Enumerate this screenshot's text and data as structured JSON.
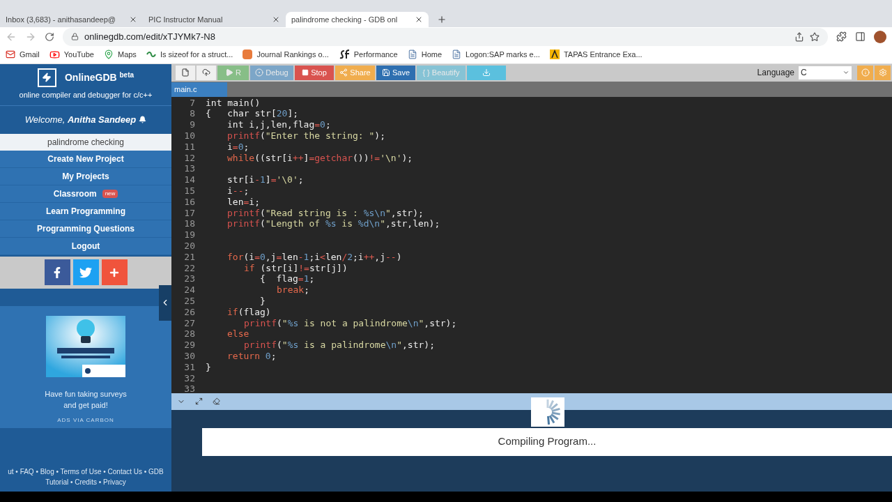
{
  "browser": {
    "tabs": [
      {
        "title": "Inbox (3,683) - anithasandeep@",
        "selected": false
      },
      {
        "title": "PIC Instructor Manual",
        "selected": false
      },
      {
        "title": "palindrome checking - GDB onl",
        "selected": true
      }
    ],
    "url": "onlinegdb.com/edit/xTJYMk7-N8",
    "bookmarks": [
      {
        "label": "Gmail",
        "kind": "mail"
      },
      {
        "label": "YouTube",
        "kind": "video"
      },
      {
        "label": "Maps",
        "kind": "map"
      },
      {
        "label": "Is sizeof for a struct...",
        "kind": "geeks"
      },
      {
        "label": "Journal Rankings o...",
        "kind": "sjr"
      },
      {
        "label": "Performance",
        "kind": "sf"
      },
      {
        "label": "Home",
        "kind": "page"
      },
      {
        "label": "Logon:SAP marks e...",
        "kind": "page"
      },
      {
        "label": "TAPAS Entrance Exa...",
        "kind": "tapas"
      }
    ]
  },
  "sidebar": {
    "brand": "OnlineGDB",
    "brand_sup": "beta",
    "tagline": "online compiler and debugger for c/c++",
    "welcome": "Welcome, ",
    "user": "Anitha Sandeep",
    "project": "palindrome checking",
    "menu": [
      {
        "label": "Create New Project"
      },
      {
        "label": "My Projects"
      },
      {
        "label": "Classroom",
        "badge": "new"
      },
      {
        "label": "Learn Programming"
      },
      {
        "label": "Programming Questions"
      },
      {
        "label": "Logout"
      }
    ],
    "ad": {
      "caption": "Have fun taking surveys and get paid!",
      "note": "ADS VIA CARBON"
    },
    "footer": [
      "ut • FAQ • Blog • Terms of Use • Contact Us • GDB",
      "Tutorial • Credits • Privacy"
    ]
  },
  "toolbar": [
    {
      "kind": "new",
      "disabled": false
    },
    {
      "kind": "upload",
      "disabled": false
    },
    {
      "kind": "run",
      "label": "R",
      "disabled": true
    },
    {
      "kind": "debug",
      "label": "Debug",
      "disabled": true
    },
    {
      "kind": "stop",
      "label": "Stop",
      "disabled": false
    },
    {
      "kind": "share",
      "label": "Share",
      "disabled": false
    },
    {
      "kind": "save",
      "label": "Save",
      "disabled": false
    },
    {
      "kind": "beautify",
      "label": "{ } Beautify",
      "disabled": true
    },
    {
      "kind": "download",
      "disabled": false
    }
  ],
  "language": {
    "label": "Language",
    "value": "C"
  },
  "file_tabs": [
    {
      "label": "main.c",
      "selected": true
    }
  ],
  "code": [
    {
      "no": "7",
      "kind": "none",
      "segs": [
        {
          "text": "int main()",
          "kind": "plain"
        }
      ]
    },
    {
      "no": "8",
      "kind": "none",
      "segs": [
        {
          "text": "{   char str[",
          "kind": "plain"
        },
        {
          "text": "20",
          "kind": "number"
        },
        {
          "text": "];",
          "kind": "plain"
        }
      ]
    },
    {
      "no": "9",
      "kind": "body",
      "segs": [
        {
          "text": "int i,j,len,flag",
          "kind": "plain"
        },
        {
          "text": "=",
          "kind": "operator"
        },
        {
          "text": "0",
          "kind": "number"
        },
        {
          "text": ";",
          "kind": "plain"
        }
      ]
    },
    {
      "no": "10",
      "kind": "body",
      "segs": [
        {
          "text": "printf",
          "kind": "call"
        },
        {
          "text": "(",
          "kind": "plain"
        },
        {
          "text": "\"Enter the string: \"",
          "kind": "string"
        },
        {
          "text": ");",
          "kind": "plain"
        }
      ]
    },
    {
      "no": "11",
      "kind": "body",
      "segs": [
        {
          "text": "i",
          "kind": "plain"
        },
        {
          "text": "=",
          "kind": "operator"
        },
        {
          "text": "0",
          "kind": "number"
        },
        {
          "text": ";",
          "kind": "plain"
        }
      ]
    },
    {
      "no": "12",
      "kind": "body",
      "segs": [
        {
          "text": "while",
          "kind": "keyword"
        },
        {
          "text": "((str[i",
          "kind": "plain"
        },
        {
          "text": "++",
          "kind": "operator"
        },
        {
          "text": "]",
          "kind": "plain"
        },
        {
          "text": "=",
          "kind": "operator"
        },
        {
          "text": "getchar",
          "kind": "call"
        },
        {
          "text": "())",
          "kind": "plain"
        },
        {
          "text": "!=",
          "kind": "operator"
        },
        {
          "text": "'\\n'",
          "kind": "string"
        },
        {
          "text": ");",
          "kind": "plain"
        }
      ]
    },
    {
      "no": "13"
    },
    {
      "no": "14",
      "kind": "body",
      "segs": [
        {
          "text": "str[i",
          "kind": "plain"
        },
        {
          "text": "-",
          "kind": "operator"
        },
        {
          "text": "1",
          "kind": "number"
        },
        {
          "text": "]",
          "kind": "plain"
        },
        {
          "text": "=",
          "kind": "operator"
        },
        {
          "text": "'\\0'",
          "kind": "string"
        },
        {
          "text": ";",
          "kind": "plain"
        }
      ]
    },
    {
      "no": "15",
      "kind": "body",
      "segs": [
        {
          "text": "i",
          "kind": "plain"
        },
        {
          "text": "--",
          "kind": "operator"
        },
        {
          "text": ";",
          "kind": "plain"
        }
      ]
    },
    {
      "no": "16",
      "kind": "body",
      "segs": [
        {
          "text": "len",
          "kind": "plain"
        },
        {
          "text": "=",
          "kind": "operator"
        },
        {
          "text": "i;",
          "kind": "plain"
        }
      ]
    },
    {
      "no": "17",
      "kind": "body",
      "segs": [
        {
          "text": "printf",
          "kind": "call"
        },
        {
          "text": "(",
          "kind": "plain"
        },
        {
          "text": "\"Read string is : ",
          "kind": "string"
        },
        {
          "text": "%s\\n",
          "kind": "number"
        },
        {
          "text": "\"",
          "kind": "string"
        },
        {
          "text": ",str);",
          "kind": "plain"
        }
      ]
    },
    {
      "no": "18",
      "kind": "body",
      "segs": [
        {
          "text": "printf",
          "kind": "call"
        },
        {
          "text": "(",
          "kind": "plain"
        },
        {
          "text": "\"Length of ",
          "kind": "string"
        },
        {
          "text": "%s",
          "kind": "number"
        },
        {
          "text": " is ",
          "kind": "string"
        },
        {
          "text": "%d\\n",
          "kind": "number"
        },
        {
          "text": "\"",
          "kind": "string"
        },
        {
          "text": ",str,len);",
          "kind": "plain"
        }
      ]
    },
    {
      "no": "19"
    },
    {
      "no": "20"
    },
    {
      "no": "21",
      "kind": "body",
      "segs": [
        {
          "text": "for",
          "kind": "keyword"
        },
        {
          "text": "(i",
          "kind": "plain"
        },
        {
          "text": "=",
          "kind": "operator"
        },
        {
          "text": "0",
          "kind": "number"
        },
        {
          "text": ",j",
          "kind": "plain"
        },
        {
          "text": "=",
          "kind": "operator"
        },
        {
          "text": "len",
          "kind": "plain"
        },
        {
          "text": "-",
          "kind": "operator"
        },
        {
          "text": "1",
          "kind": "number"
        },
        {
          "text": ";i",
          "kind": "plain"
        },
        {
          "text": "<",
          "kind": "operator"
        },
        {
          "text": "len",
          "kind": "plain"
        },
        {
          "text": "/",
          "kind": "operator"
        },
        {
          "text": "2",
          "kind": "number"
        },
        {
          "text": ";i",
          "kind": "plain"
        },
        {
          "text": "++",
          "kind": "operator"
        },
        {
          "text": ",j",
          "kind": "plain"
        },
        {
          "text": "--",
          "kind": "operator"
        },
        {
          "text": ")",
          "kind": "plain"
        }
      ]
    },
    {
      "no": "22",
      "kind": "branch",
      "segs": [
        {
          "text": "if",
          "kind": "keyword"
        },
        {
          "text": " (str[i]",
          "kind": "plain"
        },
        {
          "text": "!=",
          "kind": "operator"
        },
        {
          "text": "str[j])",
          "kind": "plain"
        }
      ]
    },
    {
      "no": "23",
      "kind": "block",
      "segs": [
        {
          "text": "{  flag",
          "kind": "plain"
        },
        {
          "text": "=",
          "kind": "operator"
        },
        {
          "text": "1",
          "kind": "number"
        },
        {
          "text": ";",
          "kind": "plain"
        }
      ]
    },
    {
      "no": "24",
      "kind": "inner",
      "segs": [
        {
          "text": "break",
          "kind": "keyword"
        },
        {
          "text": ";",
          "kind": "plain"
        }
      ]
    },
    {
      "no": "25",
      "kind": "block",
      "segs": [
        {
          "text": "}",
          "kind": "plain"
        }
      ]
    },
    {
      "no": "26",
      "kind": "body",
      "segs": [
        {
          "text": "if",
          "kind": "keyword"
        },
        {
          "text": "(flag)",
          "kind": "plain"
        }
      ]
    },
    {
      "no": "27",
      "kind": "branch",
      "segs": [
        {
          "text": "printf",
          "kind": "call"
        },
        {
          "text": "(",
          "kind": "plain"
        },
        {
          "text": "\"",
          "kind": "string"
        },
        {
          "text": "%s",
          "kind": "number"
        },
        {
          "text": " is not a palindrome",
          "kind": "string"
        },
        {
          "text": "\\n",
          "kind": "number"
        },
        {
          "text": "\"",
          "kind": "string"
        },
        {
          "text": ",str);",
          "kind": "plain"
        }
      ]
    },
    {
      "no": "28",
      "kind": "body",
      "segs": [
        {
          "text": "else",
          "kind": "keyword"
        }
      ]
    },
    {
      "no": "29",
      "kind": "branch",
      "segs": [
        {
          "text": "printf",
          "kind": "call"
        },
        {
          "text": "(",
          "kind": "plain"
        },
        {
          "text": "\"",
          "kind": "string"
        },
        {
          "text": "%s",
          "kind": "number"
        },
        {
          "text": " is a palindrome",
          "kind": "string"
        },
        {
          "text": "\\n",
          "kind": "number"
        },
        {
          "text": "\"",
          "kind": "string"
        },
        {
          "text": ",str);",
          "kind": "plain"
        }
      ]
    },
    {
      "no": "30",
      "kind": "body",
      "segs": [
        {
          "text": "return ",
          "kind": "keyword"
        },
        {
          "text": "0",
          "kind": "number"
        },
        {
          "text": ";",
          "kind": "plain"
        }
      ]
    },
    {
      "no": "31",
      "kind": "none",
      "segs": [
        {
          "text": "}",
          "kind": "plain"
        }
      ]
    },
    {
      "no": "32"
    },
    {
      "no": "33"
    }
  ],
  "console": {
    "status": "Compiling Program..."
  }
}
